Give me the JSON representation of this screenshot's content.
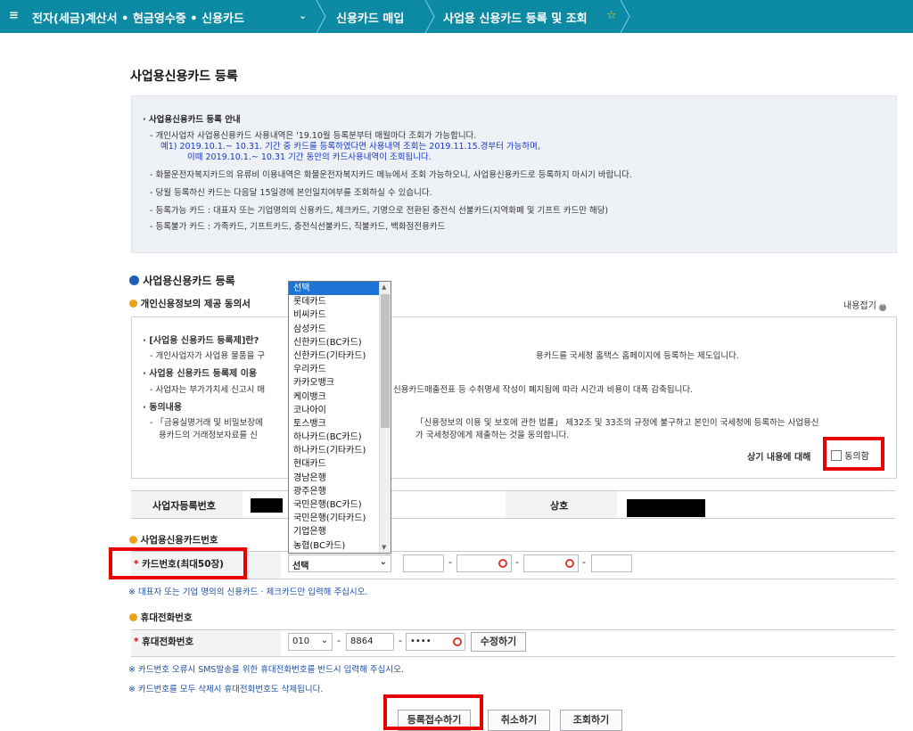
{
  "breadcrumb": {
    "menu_icon": "≡",
    "section": "전자(세금)계산서 • 현금영수증 • 신용카드",
    "level2": "신용카드 매입",
    "current": "사업용 신용카드 등록 및 조회",
    "star": "☆"
  },
  "page_title": "사업용신용카드 등록",
  "guide": {
    "heading": "· 사업용신용카드 등록 안내",
    "lines": [
      "- 개인사업자 사업용신용카드 사용내역은 '19.10월 등록분부터 매월마다 조회가 가능합니다.",
      "예1) 2019.10.1.~ 10.31. 기간 중 카드를 등록하였다면 사용내역 조회는 2019.11.15.경부터 가능하며,",
      "이때 2019.10.1.~ 10.31 기간 동안의 카드사용내역이 조회됩니다.",
      "- 화물운전자복지카드의 유류비 이용내역은 화물운전자복지카드 메뉴에서 조회 가능하오니, 사업용신용카드로 등록하지 마시기 바랍니다.",
      "- 당월 등록하신 카드는 다음달 15일경에 본인일치여부를 조회하실 수 있습니다.",
      "- 등록가능 카드 : 대표자 또는 기업명의의 신용카드, 체크카드, 기명으로 전환된 충전식 선불카드(지역화폐 및 기프트 카드만 해당)",
      "- 등록불가 카드 : 가족카드, 기프트카드, 충전식선불카드, 직불카드, 백화점전용카드"
    ]
  },
  "register_section": "사업용신용카드 등록",
  "consent": {
    "title": "개인신용정보의 제공 동의서",
    "collapse": "내용접기",
    "h1": "· [사업용 신용카드 등록제]란?",
    "l1a": "- 개인사업자가 사업용 물품을 구",
    "l1b": "용카드를 국세청 홈택스 홈페이지에 등록하는 제도입니다.",
    "h2": "· 사업용 신용카드 등록제 이용",
    "l2a": "- 사업자는 부가가치세 신고시 매",
    "l2b": "신용카드매출전표 등 수취명세 작성이 폐지됨에 따라 시간과 비용이 대폭 감축됩니다.",
    "h3": "· 동의내용",
    "l3a": "- 「금융실명거래 및 비밀보장에",
    "l3b": "「신용정보의 이용 및 보호에 관한 법률」 제32조 및 33조의 규정에 불구하고 본인이 국세청에 등록하는 사업용신",
    "l3c": "용카드의 거래정보자료를 신",
    "l3d": "가 국세청장에게 제출하는 것을 동의합니다.",
    "agree_prefix": "상기 내용에 대해",
    "agree_label": "동의함"
  },
  "business": {
    "reg_label": "사업자등록번호",
    "name_label": "상호"
  },
  "card_section": "사업용신용카드번호",
  "card": {
    "label": "카드번호(최대50장)",
    "required": "*",
    "select_value": "선택",
    "dash": "-"
  },
  "card_note": "※ 대표자 또는 기업 명의의 신용카드 · 체크카드만 입력해 주십시오.",
  "phone_section": "휴대전화번호",
  "phone": {
    "label": "휴대전화번호",
    "required": "*",
    "prefix": "010",
    "mid": "8864",
    "last": "••••",
    "edit_button": "수정하기"
  },
  "notes": [
    "※ 카드번호 오류시 SMS발송을 위한 휴대전화번호를 반드시 입력해 주십시오.",
    "※ 카드번호를 모두 삭제시 휴대전화번호도 삭제됩니다."
  ],
  "buttons": {
    "submit": "등록접수하기",
    "cancel": "취소하기",
    "lookup": "조회하기"
  },
  "card_dropdown": {
    "options": [
      "선택",
      "롯데카드",
      "비씨카드",
      "삼성카드",
      "신한카드(BC카드)",
      "신한카드(기타카드)",
      "우리카드",
      "카카오뱅크",
      "케이뱅크",
      "코나아이",
      "토스뱅크",
      "하나카드(BC카드)",
      "하나카드(기타카드)",
      "현대카드",
      "경남은행",
      "광주은행",
      "국민은행(BC카드)",
      "국민은행(기타카드)",
      "기업은행",
      "농협(BC카드)"
    ],
    "selected_index": 0
  }
}
